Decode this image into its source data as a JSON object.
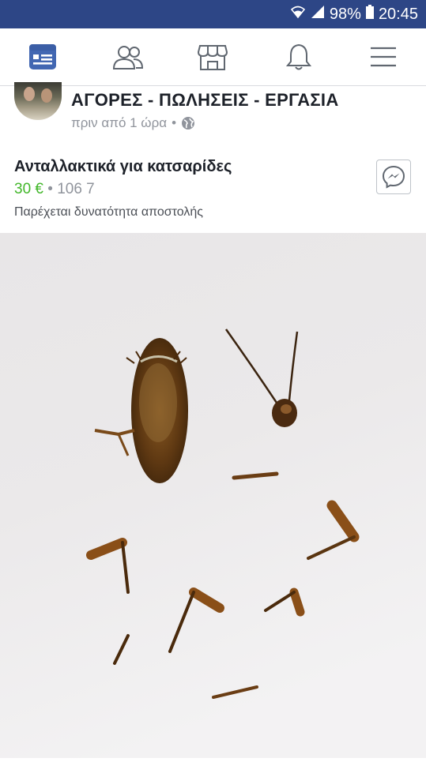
{
  "status_bar": {
    "battery": "98%",
    "time": "20:45"
  },
  "nav": {
    "items": [
      "news-feed",
      "friends",
      "marketplace",
      "notifications",
      "menu"
    ]
  },
  "post": {
    "group_name": "ΑΓΟΡΕΣ - ΠΩΛΗΣΕΙΣ - ΕΡΓΑΣΙΑ",
    "time": "πριν από 1 ώρα",
    "separator": "•"
  },
  "listing": {
    "title": "Ανταλλακτικά για κατσαρίδες",
    "price": "30 €",
    "separator": "•",
    "location": "106 7",
    "shipping": "Παρέχεται δυνατότητα αποστολής"
  },
  "colors": {
    "status_bar": "#2d4686",
    "accent": "#4267b2",
    "price": "#42b72a"
  }
}
